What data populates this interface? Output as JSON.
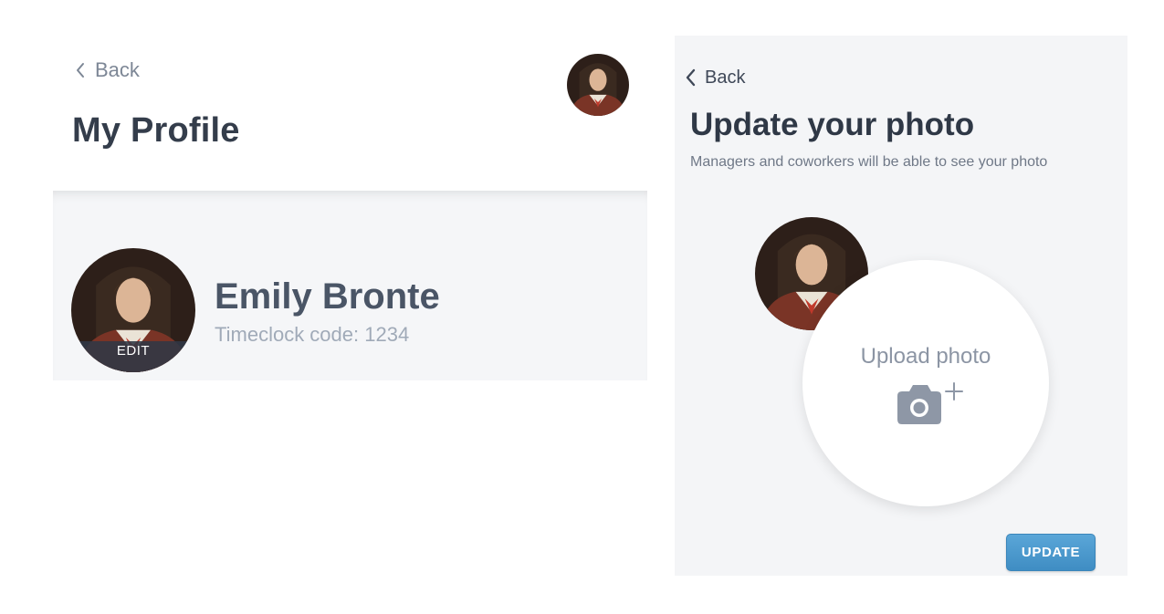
{
  "profile_screen": {
    "back_label": "Back",
    "title": "My Profile",
    "user_name": "Emily Bronte",
    "timeclock_code": "Timeclock code: 1234",
    "avatar_edit_label": "EDIT"
  },
  "photo_screen": {
    "back_label": "Back",
    "title": "Update your photo",
    "subtitle": "Managers and coworkers will be able to see your photo",
    "upload_label": "Upload photo",
    "upload_icon": "camera-plus-icon",
    "update_button_label": "UPDATE"
  },
  "colors": {
    "accent": "#4a9ad0",
    "card_background": "#f5f6f8",
    "panel_background": "#f4f5f7",
    "title_text": "#343d4b",
    "muted_text": "#a0aab8"
  }
}
